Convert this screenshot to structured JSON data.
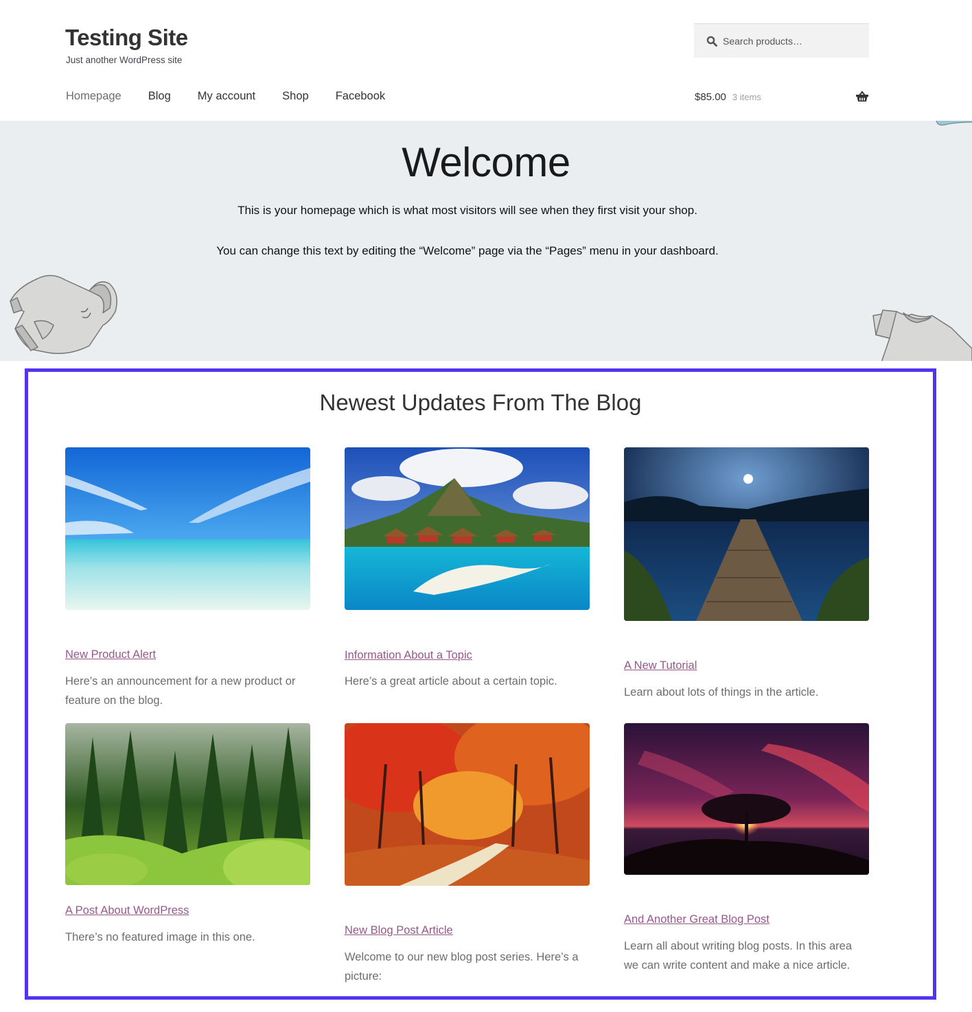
{
  "header": {
    "site_title": "Testing Site",
    "tagline": "Just another WordPress site",
    "search": {
      "placeholder": "Search products…",
      "value": "",
      "icon": "search-icon"
    },
    "nav": [
      {
        "label": "Homepage",
        "current": true
      },
      {
        "label": "Blog",
        "current": false
      },
      {
        "label": "My account",
        "current": false
      },
      {
        "label": "Shop",
        "current": false
      },
      {
        "label": "Facebook",
        "current": false
      }
    ],
    "cart": {
      "amount": "$85.00",
      "count": "3 items",
      "icon": "basket-icon"
    }
  },
  "hero": {
    "title": "Welcome",
    "paragraphs": [
      "This is your homepage which is what most visitors will see when they first visit your shop.",
      "You can change this text by editing the “Welcome” page via the “Pages” menu in your dashboard."
    ],
    "decorations": [
      "hoodie-illustration",
      "tshirt-illustration",
      "scarf-illustration"
    ]
  },
  "blog": {
    "heading": "Newest Updates From The Blog",
    "highlight_color": "#5333ed",
    "link_color": "#96588a",
    "posts": [
      {
        "title": "New Product Alert",
        "excerpt": "Here’s an announcement for a new product or feature on the blog.",
        "image": "tropical-beach-photo"
      },
      {
        "title": "Information About a Topic",
        "excerpt": "Here’s a great article about a certain topic.",
        "image": "island-bungalows-photo"
      },
      {
        "title": "A New Tutorial",
        "excerpt": "Learn about lots of things in the article.",
        "image": "lake-pier-night-photo"
      },
      {
        "title": "A Post About WordPress",
        "excerpt": "There’s no featured image in this one.",
        "image": "pine-forest-photo"
      },
      {
        "title": "New Blog Post Article",
        "excerpt": "Welcome to our new blog post series. Here’s a picture:",
        "image": "autumn-path-photo"
      },
      {
        "title": "And Another Great Blog Post",
        "excerpt": "Learn all about writing blog posts. In this area we can write content and make a nice article.",
        "image": "sunset-tree-photo"
      }
    ]
  }
}
